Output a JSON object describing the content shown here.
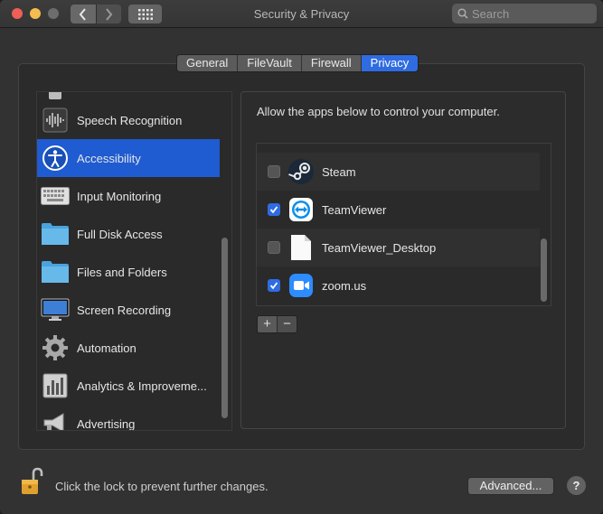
{
  "window": {
    "title": "Security & Privacy",
    "colors": {
      "accent": "#2f6ce2",
      "selection": "#1f5bd1",
      "close": "#ee5f57",
      "minimize": "#f4bd4f"
    }
  },
  "toolbar": {
    "back_icon": "chevron-left-icon",
    "forward_icon": "chevron-right-icon",
    "grid_icon": "show-all-grid-icon",
    "search_placeholder": "Search"
  },
  "tabs": [
    {
      "label": "General",
      "selected": false
    },
    {
      "label": "FileVault",
      "selected": false
    },
    {
      "label": "Firewall",
      "selected": false
    },
    {
      "label": "Privacy",
      "selected": true
    }
  ],
  "sidebar": {
    "items": [
      {
        "label": "Speech Recognition",
        "icon": "waveform-icon",
        "selected": false
      },
      {
        "label": "Accessibility",
        "icon": "accessibility-icon",
        "selected": true
      },
      {
        "label": "Input Monitoring",
        "icon": "keyboard-icon",
        "selected": false
      },
      {
        "label": "Full Disk Access",
        "icon": "folder-icon",
        "selected": false
      },
      {
        "label": "Files and Folders",
        "icon": "folder-icon",
        "selected": false
      },
      {
        "label": "Screen Recording",
        "icon": "display-icon",
        "selected": false
      },
      {
        "label": "Automation",
        "icon": "gear-icon",
        "selected": false
      },
      {
        "label": "Analytics & Improveme...",
        "icon": "bar-chart-icon",
        "selected": false
      },
      {
        "label": "Advertising",
        "icon": "megaphone-icon",
        "selected": false
      }
    ]
  },
  "main": {
    "description": "Allow the apps below to control your computer.",
    "apps": [
      {
        "name": "Steam",
        "checked": false,
        "icon": "steam-icon"
      },
      {
        "name": "TeamViewer",
        "checked": true,
        "icon": "teamviewer-icon"
      },
      {
        "name": "TeamViewer_Desktop",
        "checked": false,
        "icon": "document-icon"
      },
      {
        "name": "zoom.us",
        "checked": true,
        "icon": "zoom-camera-icon"
      }
    ],
    "add_label": "+",
    "remove_label": "−"
  },
  "footer": {
    "lock_text": "Click the lock to prevent further changes.",
    "advanced_label": "Advanced...",
    "help_label": "?"
  }
}
